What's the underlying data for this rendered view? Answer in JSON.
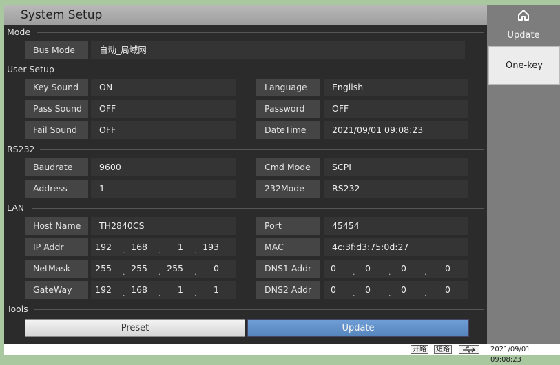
{
  "title": "System Setup",
  "sidebar": {
    "update_label": "Update",
    "onekey_label": "One-key"
  },
  "sections": {
    "mode": "Mode",
    "user_setup": "User Setup",
    "rs232": "RS232",
    "lan": "LAN",
    "tools": "Tools"
  },
  "mode": {
    "bus_mode_label": "Bus Mode",
    "bus_mode_value": "自动_局域网"
  },
  "user_setup": {
    "key_sound_label": "Key Sound",
    "key_sound_value": "ON",
    "pass_sound_label": "Pass Sound",
    "pass_sound_value": "OFF",
    "fail_sound_label": "Fail Sound",
    "fail_sound_value": "OFF",
    "language_label": "Language",
    "language_value": "English",
    "password_label": "Password",
    "password_value": "OFF",
    "datetime_label": "DateTime",
    "datetime_value": "2021/09/01 09:08:23"
  },
  "rs232": {
    "baudrate_label": "Baudrate",
    "baudrate_value": "9600",
    "address_label": "Address",
    "address_value": "1",
    "cmd_mode_label": "Cmd Mode",
    "cmd_mode_value": "SCPI",
    "mode232_label": "232Mode",
    "mode232_value": "RS232"
  },
  "lan": {
    "host_name_label": "Host Name",
    "host_name_value": "TH2840CS",
    "ip_label": "IP Addr",
    "ip": [
      "192",
      "168",
      "1",
      "193"
    ],
    "netmask_label": "NetMask",
    "netmask": [
      "255",
      "255",
      "255",
      "0"
    ],
    "gateway_label": "GateWay",
    "gateway": [
      "192",
      "168",
      "1",
      "1"
    ],
    "port_label": "Port",
    "port_value": "45454",
    "mac_label": "MAC Address",
    "mac_value": "4c:3f:d3:75:0d:27",
    "dns1_label": "DNS1 Addr",
    "dns1": [
      "0",
      "0",
      "0",
      "0"
    ],
    "dns2_label": "DNS2 Addr",
    "dns2": [
      "0",
      "0",
      "0",
      "0"
    ]
  },
  "tools": {
    "preset_label": "Preset",
    "update_label": "Update"
  },
  "status": {
    "open_label": "开路",
    "short_label": "短路",
    "usb_icon": "usb-icon",
    "time": "2021/09/01 09:08:23"
  },
  "colors": {
    "accent_blue": "#5f8fcb",
    "sidebar_bg": "#7d7d7d",
    "panel_bg": "#2b2b2b"
  }
}
